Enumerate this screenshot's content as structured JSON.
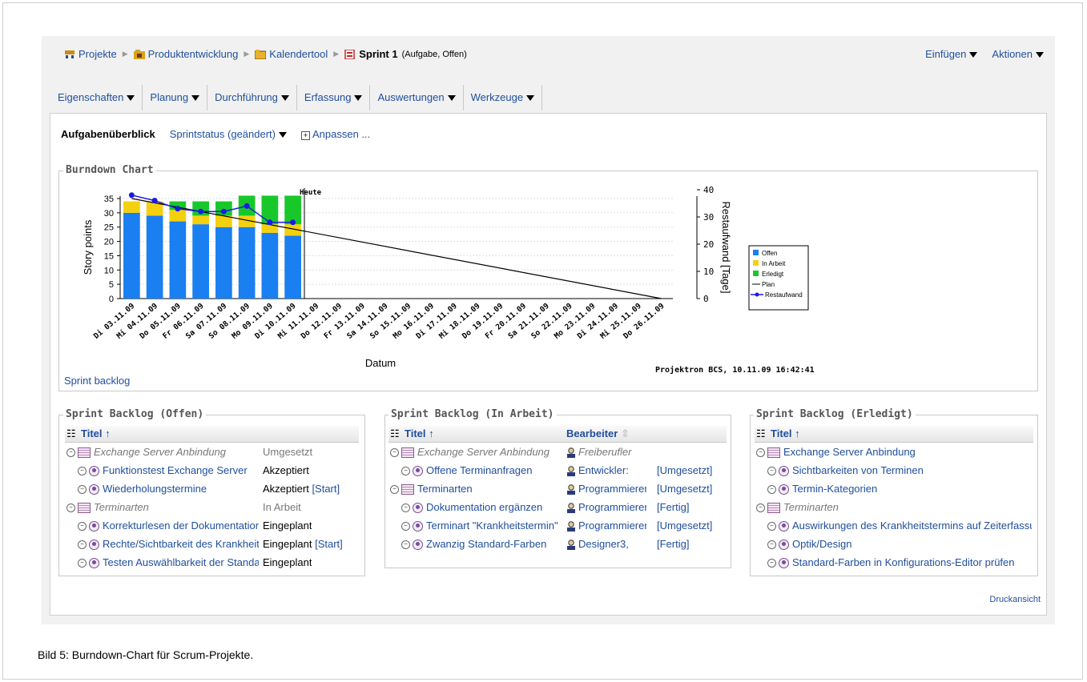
{
  "breadcrumb": {
    "items": [
      "Projekte",
      "Produktentwicklung",
      "Kalendertool"
    ],
    "current": "Sprint 1",
    "current_sub": "(Aufgabe, Offen)"
  },
  "top_actions": {
    "insert": "Einfügen",
    "actions": "Aktionen"
  },
  "tabs": [
    "Eigenschaften",
    "Planung",
    "Durchführung",
    "Erfassung",
    "Auswertungen",
    "Werkzeuge"
  ],
  "subnav": {
    "overview": "Aufgabenüberblick",
    "status": "Sprintstatus (geändert)",
    "customize": "Anpassen ..."
  },
  "chart_section": {
    "title": "Burndown Chart",
    "link": "Sprint backlog",
    "footer": "Projektron BCS, 10.11.09  16:42:41"
  },
  "chart_data": {
    "type": "bar",
    "categories": [
      "Di 03.11.09",
      "Mi 04.11.09",
      "Do 05.11.09",
      "Fr 06.11.09",
      "Sa 07.11.09",
      "So 08.11.09",
      "Mo 09.11.09",
      "Di 10.11.09",
      "Mi 11.11.09",
      "Do 12.11.09",
      "Fr 13.11.09",
      "Sa 14.11.09",
      "So 15.11.09",
      "Mo 16.11.09",
      "Di 17.11.09",
      "Mi 18.11.09",
      "Do 19.11.09",
      "Fr 20.11.09",
      "Sa 21.11.09",
      "So 22.11.09",
      "Mo 23.11.09",
      "Di 24.11.09",
      "Mi 25.11.09",
      "Do 26.11.09"
    ],
    "series": [
      {
        "name": "Offen",
        "color": "#1a7ff0",
        "values": [
          30,
          29,
          27,
          26,
          25,
          25,
          23,
          22
        ]
      },
      {
        "name": "In Arbeit",
        "color": "#f5d00f",
        "values": [
          4,
          5,
          4,
          3,
          4,
          4,
          3,
          4
        ]
      },
      {
        "name": "Erledigt",
        "color": "#18c82a",
        "values": [
          0,
          0,
          3,
          5,
          5,
          7,
          10,
          10
        ]
      },
      {
        "name": "Plan",
        "color": "#000000",
        "values": [
          35,
          0
        ]
      },
      {
        "name": "Restaufwand",
        "color": "#1a1ae6",
        "values": [
          38,
          36,
          33,
          32,
          32,
          34,
          28,
          28
        ]
      }
    ],
    "xlabel": "Datum",
    "ylabel": "Story points",
    "y2label": "Restaufwand [Tage]",
    "ylim": [
      0,
      35
    ],
    "yticks": [
      0,
      5,
      10,
      15,
      20,
      25,
      30,
      35
    ],
    "y2lim": [
      0,
      40
    ],
    "y2ticks": [
      0,
      10,
      20,
      30,
      40
    ],
    "today_label": "Heute",
    "legend_position": "right"
  },
  "backlog_offen": {
    "title": "Sprint Backlog (Offen)",
    "col_title": "Titel",
    "rows": [
      {
        "title": "Exchange Server Anbindung",
        "status": "Umgesetzt",
        "action": ""
      },
      {
        "title": "Funktionstest Exchange Server",
        "status": "Akzeptiert",
        "action": ""
      },
      {
        "title": "Wiederholungstermine",
        "status": "Akzeptiert",
        "action": "[Start]"
      },
      {
        "title": "Terminarten",
        "status": "In Arbeit",
        "action": ""
      },
      {
        "title": "Korrekturlesen der Dokumentation",
        "status": "Eingeplant",
        "action": ""
      },
      {
        "title": "Rechte/Sichtbarkeit des Krankheitstermins",
        "status": "Eingeplant",
        "action": "[Start]"
      },
      {
        "title": "Testen Auswählbarkeit der Standard-Farben",
        "status": "Eingeplant",
        "action": ""
      }
    ]
  },
  "backlog_arbeit": {
    "title": "Sprint Backlog (In Arbeit)",
    "col_title": "Titel",
    "col_worker": "Bearbeiter",
    "rows": [
      {
        "title": "Exchange Server Anbindung",
        "worker": "Freiberufler",
        "action": ""
      },
      {
        "title": "Offene Terminanfragen",
        "worker": "Entwickler:",
        "action": "[Umgesetzt]"
      },
      {
        "title": "Terminarten",
        "worker": "Programmierer",
        "action": "[Umgesetzt]"
      },
      {
        "title": "Dokumentation ergänzen",
        "worker": "Programmierer",
        "action": "[Fertig]"
      },
      {
        "title": "Terminart \"Krankheitstermin\"",
        "worker": "Programmierer",
        "action": "[Umgesetzt]"
      },
      {
        "title": "Zwanzig Standard-Farben",
        "worker": "Designer3,",
        "action": "[Fertig]"
      }
    ]
  },
  "backlog_erledigt": {
    "title": "Sprint Backlog (Erledigt)",
    "col_title": "Titel",
    "rows": [
      {
        "title": "Exchange Server Anbindung"
      },
      {
        "title": "Sichtbarkeiten von Terminen"
      },
      {
        "title": "Termin-Kategorien"
      },
      {
        "title": "Terminarten"
      },
      {
        "title": "Auswirkungen des Krankheitstermins auf Zeiterfassung"
      },
      {
        "title": "Optik/Design"
      },
      {
        "title": "Standard-Farben in Konfigurations-Editor prüfen"
      }
    ]
  },
  "print_link": "Druckansicht",
  "caption": "Bild 5:  Burndown-Chart für Scrum-Projekte."
}
